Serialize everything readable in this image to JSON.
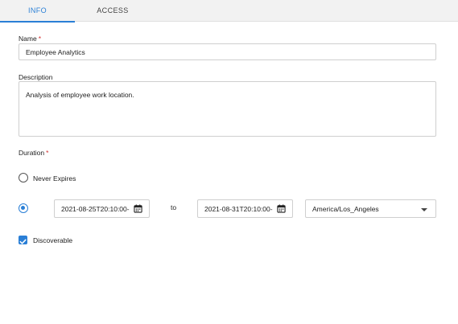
{
  "tabs": [
    {
      "label": "INFO",
      "active": true
    },
    {
      "label": "ACCESS",
      "active": false
    }
  ],
  "form": {
    "name_label": "Name",
    "name_value": "Employee Analytics",
    "description_label": "Description",
    "description_value": "Analysis of employee work location.",
    "duration_label": "Duration",
    "required_mark": "*",
    "never_expires_label": "Never Expires",
    "start_datetime": "2021-08-25T20:10:00-",
    "to_label": "to",
    "end_datetime": "2021-08-31T20:10:00-",
    "timezone": "America/Los_Angeles",
    "discoverable_label": "Discoverable",
    "discoverable_checked": true,
    "selected_duration": "range"
  },
  "icons": {
    "calendar": "calendar-icon",
    "dropdown": "chevron-down-icon",
    "check": "check-icon"
  },
  "colors": {
    "accent": "#2a7fd6",
    "required": "#d32f2f",
    "tabbar_bg": "#f2f2f2",
    "border": "#cfcfcf"
  }
}
